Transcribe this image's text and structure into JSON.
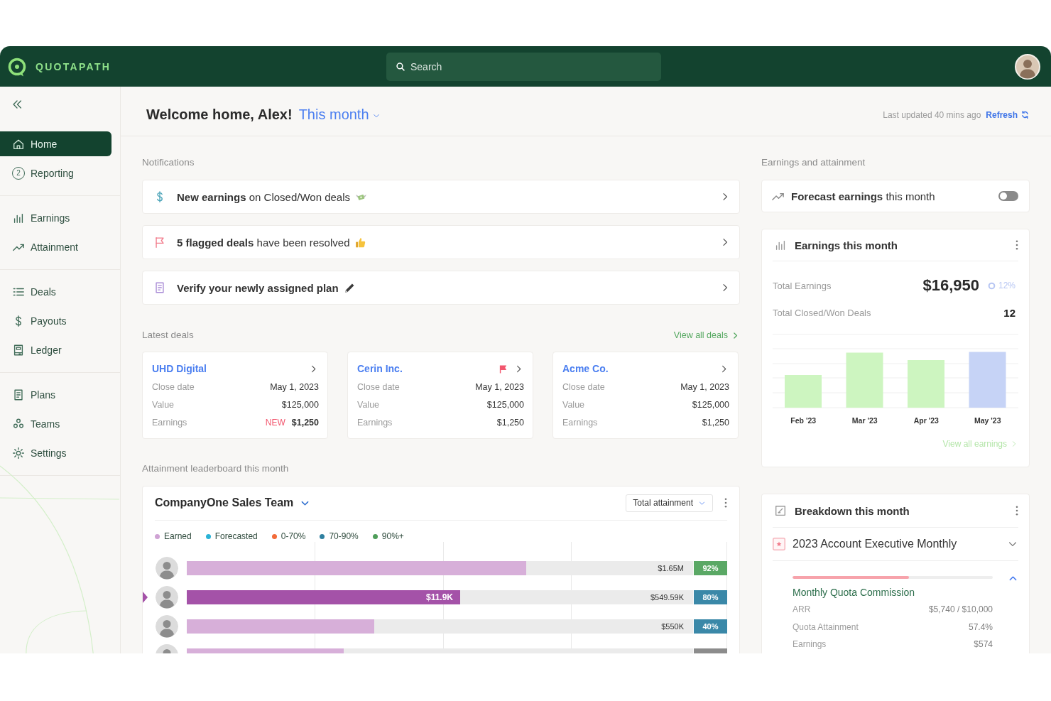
{
  "topbar": {
    "brand": "QUOTAPATH",
    "search": {
      "placeholder": "Search"
    }
  },
  "sidebar": {
    "groups": [
      {
        "items": [
          {
            "label": "Home",
            "selected": true
          },
          {
            "label": "Reporting",
            "selected": false,
            "count": "2"
          }
        ]
      },
      {
        "items": [
          {
            "label": "Earnings",
            "selected": false
          },
          {
            "label": "Attainment",
            "selected": false
          }
        ]
      },
      {
        "items": [
          {
            "label": "Deals",
            "selected": false
          },
          {
            "label": "Payouts",
            "selected": false
          },
          {
            "label": "Ledger",
            "selected": false
          }
        ]
      },
      {
        "items": [
          {
            "label": "Plans",
            "selected": false
          },
          {
            "label": "Teams",
            "selected": false
          },
          {
            "label": "Settings",
            "selected": false
          }
        ]
      }
    ]
  },
  "header": {
    "greeting": "Welcome home, Alex!",
    "period": "This month",
    "last_updated": "Last updated 40 mins ago",
    "refresh": "Refresh"
  },
  "notifications": {
    "title": "Notifications",
    "items": [
      {
        "kind": "earnings",
        "text": "**New earnings** on Closed/Won deals"
      },
      {
        "kind": "flagged",
        "text": "**5 flagged deals** have been resolved"
      },
      {
        "kind": "plan",
        "text": "**Verify your newly assigned plan**"
      }
    ]
  },
  "latest_deals": {
    "title": "Latest deals",
    "view_all": "View all deals",
    "deals": [
      {
        "name": "UHD Digital",
        "flagged": false,
        "rows": [
          {
            "label": "Close date",
            "value": "May 1, 2023"
          },
          {
            "label": "Value",
            "value": "$125,000"
          },
          {
            "label": "Earnings",
            "value": "$1,250",
            "badge": "NEW"
          }
        ]
      },
      {
        "name": "Cerin Inc.",
        "flagged": true,
        "rows": [
          {
            "label": "Close date",
            "value": "May 1, 2023"
          },
          {
            "label": "Value",
            "value": "$125,000"
          },
          {
            "label": "Earnings",
            "value": "$1,250"
          }
        ]
      },
      {
        "name": "Acme Co.",
        "flagged": false,
        "rows": [
          {
            "label": "Close date",
            "value": "May 1, 2023"
          },
          {
            "label": "Value",
            "value": "$125,000"
          },
          {
            "label": "Earnings",
            "value": "$1,250"
          }
        ]
      }
    ]
  },
  "leaderboard": {
    "title": "Attainment leaderboard this month",
    "team": "CompanyOne Sales Team",
    "metric": "Total attainment",
    "legend": [
      {
        "label": "Earned",
        "color": "#cfa3d4"
      },
      {
        "label": "Forecasted",
        "color": "#2bb3d6"
      },
      {
        "label": "0-70%",
        "color": "#f26b3a"
      },
      {
        "label": "70-90%",
        "color": "#2f80a0"
      },
      {
        "label": "90%+",
        "color": "#4f9e5a"
      }
    ],
    "rows": [
      {
        "selected": false,
        "level": 0.67,
        "total": "$1.65M",
        "percent": "92%",
        "color": "#5aa865"
      },
      {
        "selected": true,
        "level": 0.54,
        "fill_label": "$11.9K",
        "total": "$549.59K",
        "percent": "80%",
        "color": "#3a88a8"
      },
      {
        "selected": false,
        "level": 0.37,
        "total": "$550K",
        "percent": "40%",
        "color": "#3a88a8"
      },
      {
        "selected": false,
        "level": 0.31,
        "color": "#8c8c8c"
      }
    ]
  },
  "earnings_attainment": {
    "title": "Earnings and attainment",
    "forecast": {
      "text": "**Forecast earnings** this month",
      "on": false
    },
    "earnings": {
      "title": "Earnings this month",
      "total_label": "Total Earnings",
      "total": "$16,950",
      "change": "12%",
      "deals_label": "Total Closed/Won Deals",
      "deals": "12",
      "months": [
        {
          "label": "Feb '23",
          "current": false
        },
        {
          "label": "Mar '23",
          "current": false
        },
        {
          "label": "Apr '23",
          "current": false
        },
        {
          "label": "May '23",
          "current": true
        }
      ],
      "view_all": "View all earnings"
    },
    "breakdown": {
      "title": "Breakdown this month",
      "plan": "2023 Account Executive Monthly",
      "component": {
        "name": "Monthly Quota Commission",
        "level": 0.58,
        "rows": [
          {
            "label": "ARR",
            "value": "$5,740 / $10,000"
          },
          {
            "label": "Quota Attainment",
            "value": "57.4%"
          },
          {
            "label": "Earnings",
            "value": "$574"
          }
        ]
      }
    }
  }
}
